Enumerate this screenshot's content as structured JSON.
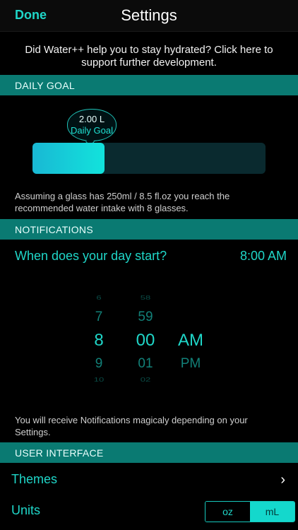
{
  "nav": {
    "done_label": "Done",
    "title": "Settings"
  },
  "support_text_line1": "Did Water++ help you to stay hydrated? Click here to",
  "support_text_line2": "support further development.",
  "daily_goal": {
    "header": "DAILY GOAL",
    "bubble_value": "2.00 L",
    "bubble_label": "Daily Goal",
    "progress_fraction": 0.31,
    "note_line1": "Assuming a glass has 250ml / 8.5 fl.oz you reach the",
    "note_line2": "recommended water intake with 8 glasses."
  },
  "notifications": {
    "header": "NOTIFICATIONS",
    "day_start_label": "When does your day start?",
    "day_start_value": "8:00 AM",
    "picker": {
      "hours": [
        "6",
        "7",
        "8",
        "9",
        "10"
      ],
      "minutes": [
        "58",
        "59",
        "00",
        "01",
        "02"
      ],
      "ampm": [
        "AM",
        "PM"
      ]
    },
    "note_line1": "You will receive Notifications magicaly depending on your",
    "note_line2": "Settings."
  },
  "user_interface": {
    "header": "USER INTERFACE",
    "themes_label": "Themes",
    "chevron_glyph": "›",
    "units_label": "Units",
    "units_options": [
      "oz",
      "mL"
    ],
    "units_selected": "mL"
  },
  "colors": {
    "accent": "#1fd6c8",
    "section": "#0a7a72",
    "fill_start": "#19b8d4",
    "fill_end": "#12e3dc"
  }
}
